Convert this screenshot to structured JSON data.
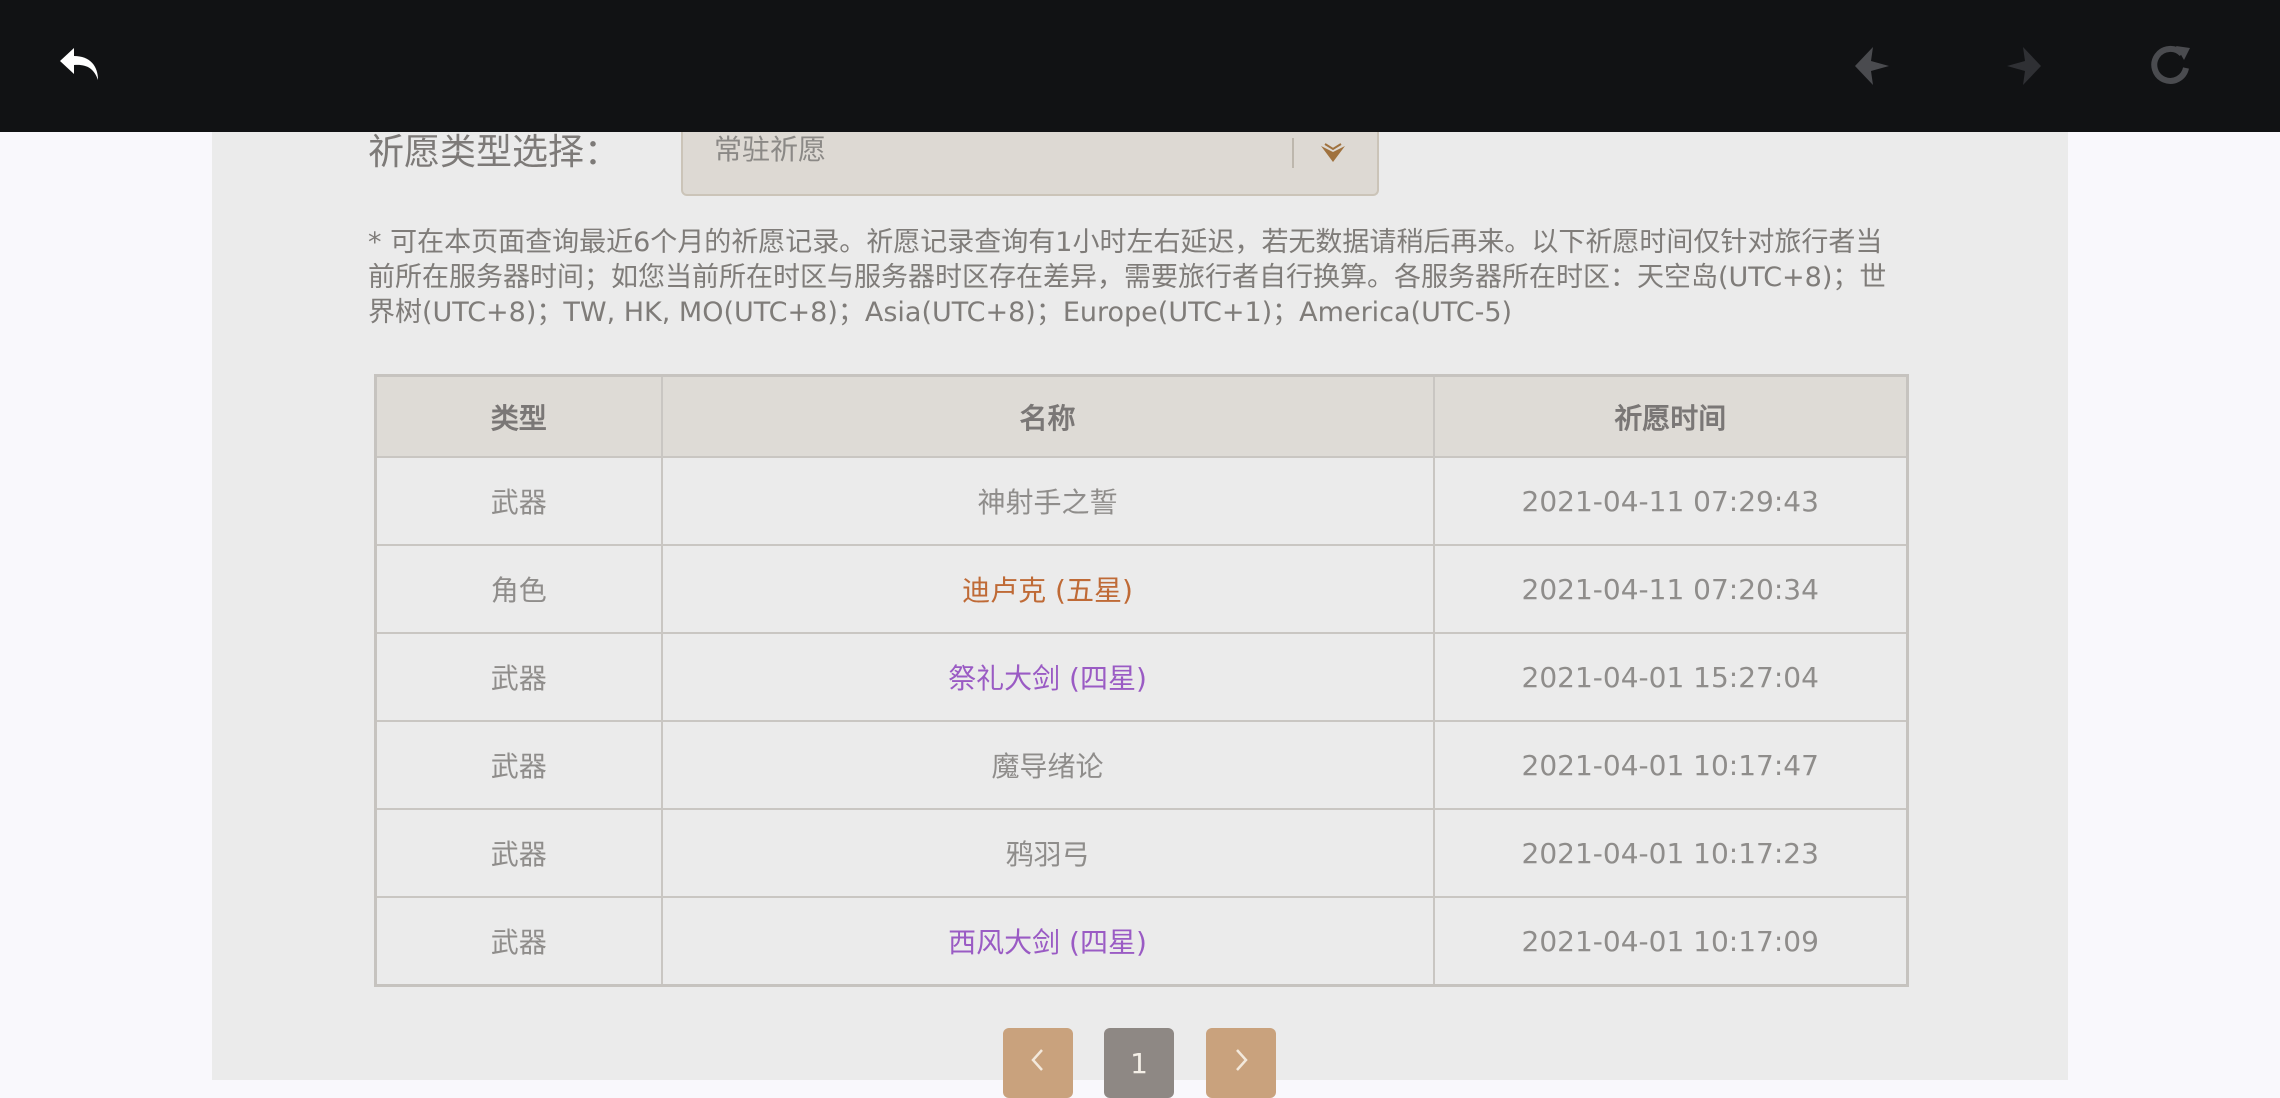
{
  "colors": {
    "topbar": "#111214",
    "five_star": "#bf6a36",
    "four_star": "#9a5bc4",
    "normal": "#8f8d8b",
    "pager_nav": "#c9a27d",
    "pager_current": "#8e8884"
  },
  "topbar": {
    "back_icon": "back-arrow-icon",
    "nav_back_icon": "diamond-left-icon",
    "nav_forward_icon": "diamond-right-icon",
    "refresh_icon": "refresh-icon"
  },
  "filter": {
    "label": "祈愿类型选择：",
    "selected": "常驻祈愿"
  },
  "notice": "* 可在本页面查询最近6个月的祈愿记录。祈愿记录查询有1小时左右延迟，若无数据请稍后再来。以下祈愿时间仅针对旅行者当前所在服务器时间；如您当前所在时区与服务器时区存在差异，需要旅行者自行换算。各服务器所在时区：天空岛(UTC+8)；世界树(UTC+8)；TW, HK, MO(UTC+8)；Asia(UTC+8)；Europe(UTC+1)；America(UTC-5)",
  "table": {
    "headers": {
      "type": "类型",
      "name": "名称",
      "time": "祈愿时间"
    },
    "rows": [
      {
        "type": "武器",
        "name": "神射手之誓",
        "time": "2021-04-11 07:29:43",
        "rarity": "normal"
      },
      {
        "type": "角色",
        "name": "迪卢克 (五星)",
        "time": "2021-04-11 07:20:34",
        "rarity": "five_star"
      },
      {
        "type": "武器",
        "name": "祭礼大剑 (四星)",
        "time": "2021-04-01 15:27:04",
        "rarity": "four_star"
      },
      {
        "type": "武器",
        "name": "魔导绪论",
        "time": "2021-04-01 10:17:47",
        "rarity": "normal"
      },
      {
        "type": "武器",
        "name": "鸦羽弓",
        "time": "2021-04-01 10:17:23",
        "rarity": "normal"
      },
      {
        "type": "武器",
        "name": "西风大剑 (四星)",
        "time": "2021-04-01 10:17:09",
        "rarity": "four_star"
      }
    ]
  },
  "pagination": {
    "prev_icon": "chevron-left-icon",
    "current": "1",
    "next_icon": "chevron-right-icon"
  }
}
